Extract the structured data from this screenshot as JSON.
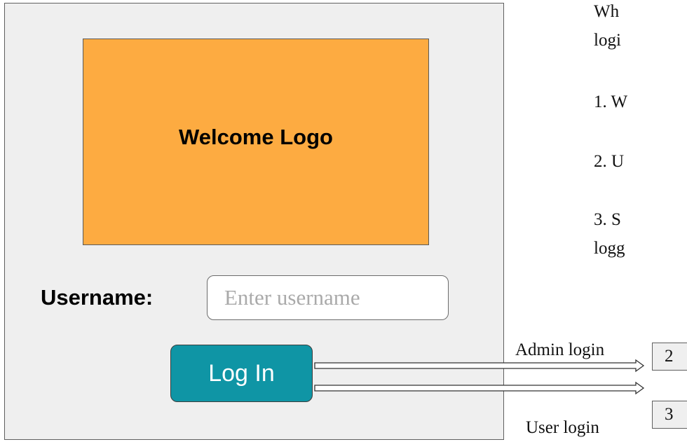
{
  "login_panel": {
    "logo_text": "Welcome Logo",
    "username_label": "Username:",
    "username_placeholder": "Enter username",
    "username_value": "",
    "login_button_label": "Log In"
  },
  "description": {
    "lines": [
      "Wh",
      "logi",
      "1. W",
      "2. U",
      "3. S",
      "logg"
    ]
  },
  "annotations": {
    "admin_label": "Admin login",
    "user_label": "User login",
    "admin_target": "2",
    "user_target": "3"
  },
  "colors": {
    "logo_background": "#fdab41",
    "button_background": "#0f95a5",
    "panel_background": "#efefef"
  }
}
